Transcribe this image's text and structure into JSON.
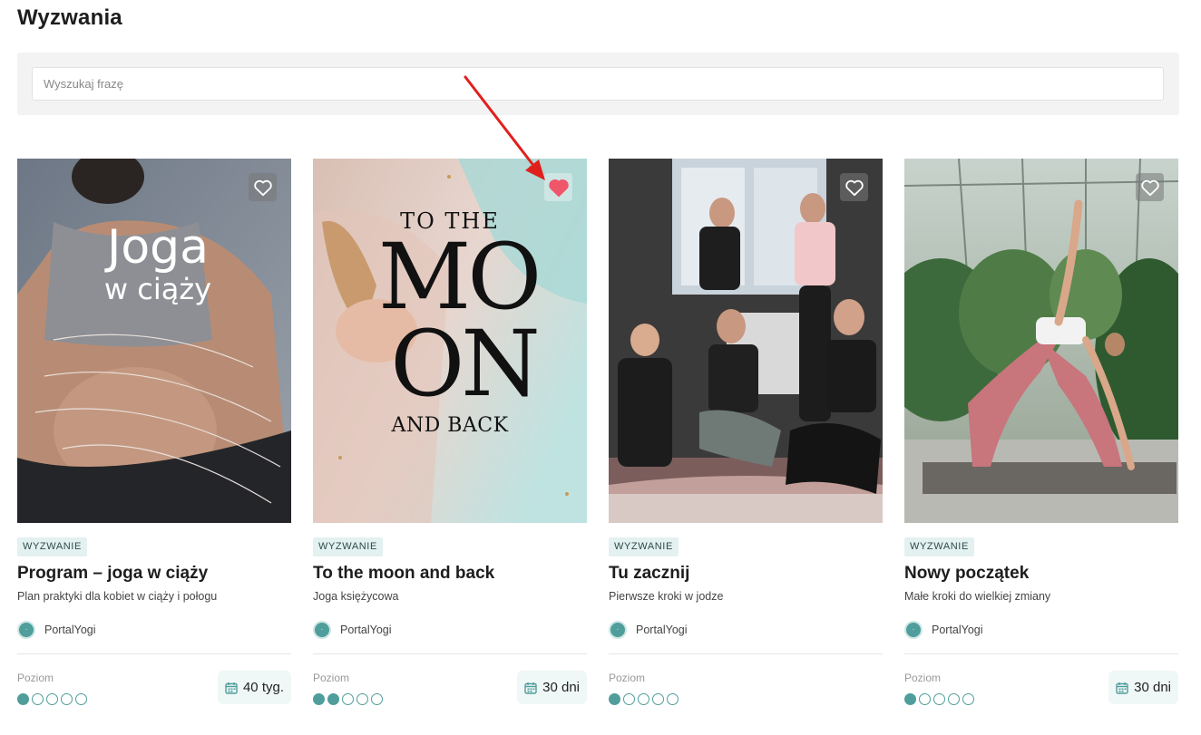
{
  "page": {
    "title": "Wyzwania"
  },
  "search": {
    "placeholder": "Wyszukaj frazę"
  },
  "cards": [
    {
      "tag": "WYZWANIE",
      "title": "Program – joga w ciąży",
      "subtitle": "Plan praktyki dla kobiet w ciąży i połogu",
      "author": "PortalYogi",
      "level_label": "Poziom",
      "level": 1,
      "level_max": 5,
      "duration": "40 tyg.",
      "favorite": false,
      "image_text": [
        "Joga",
        "w ciąży"
      ]
    },
    {
      "tag": "WYZWANIE",
      "title": "To the moon and back",
      "subtitle": "Joga księżycowa",
      "author": "PortalYogi",
      "level_label": "Poziom",
      "level": 2,
      "level_max": 5,
      "duration": "30 dni",
      "favorite": true,
      "image_text": [
        "TO THE",
        "MO",
        "ON",
        "AND BACK"
      ]
    },
    {
      "tag": "WYZWANIE",
      "title": "Tu zacznij",
      "subtitle": "Pierwsze kroki w jodze",
      "author": "PortalYogi",
      "level_label": "Poziom",
      "level": 1,
      "level_max": 5,
      "duration": "",
      "favorite": false,
      "image_text": []
    },
    {
      "tag": "WYZWANIE",
      "title": "Nowy początek",
      "subtitle": "Małe kroki do wielkiej zmiany",
      "author": "PortalYogi",
      "level_label": "Poziom",
      "level": 1,
      "level_max": 5,
      "duration": "30 dni",
      "favorite": false,
      "image_text": []
    }
  ],
  "colors": {
    "accent": "#4f9e9c",
    "favorite_active": "#f0566a",
    "annotation_arrow": "#e0201c"
  }
}
